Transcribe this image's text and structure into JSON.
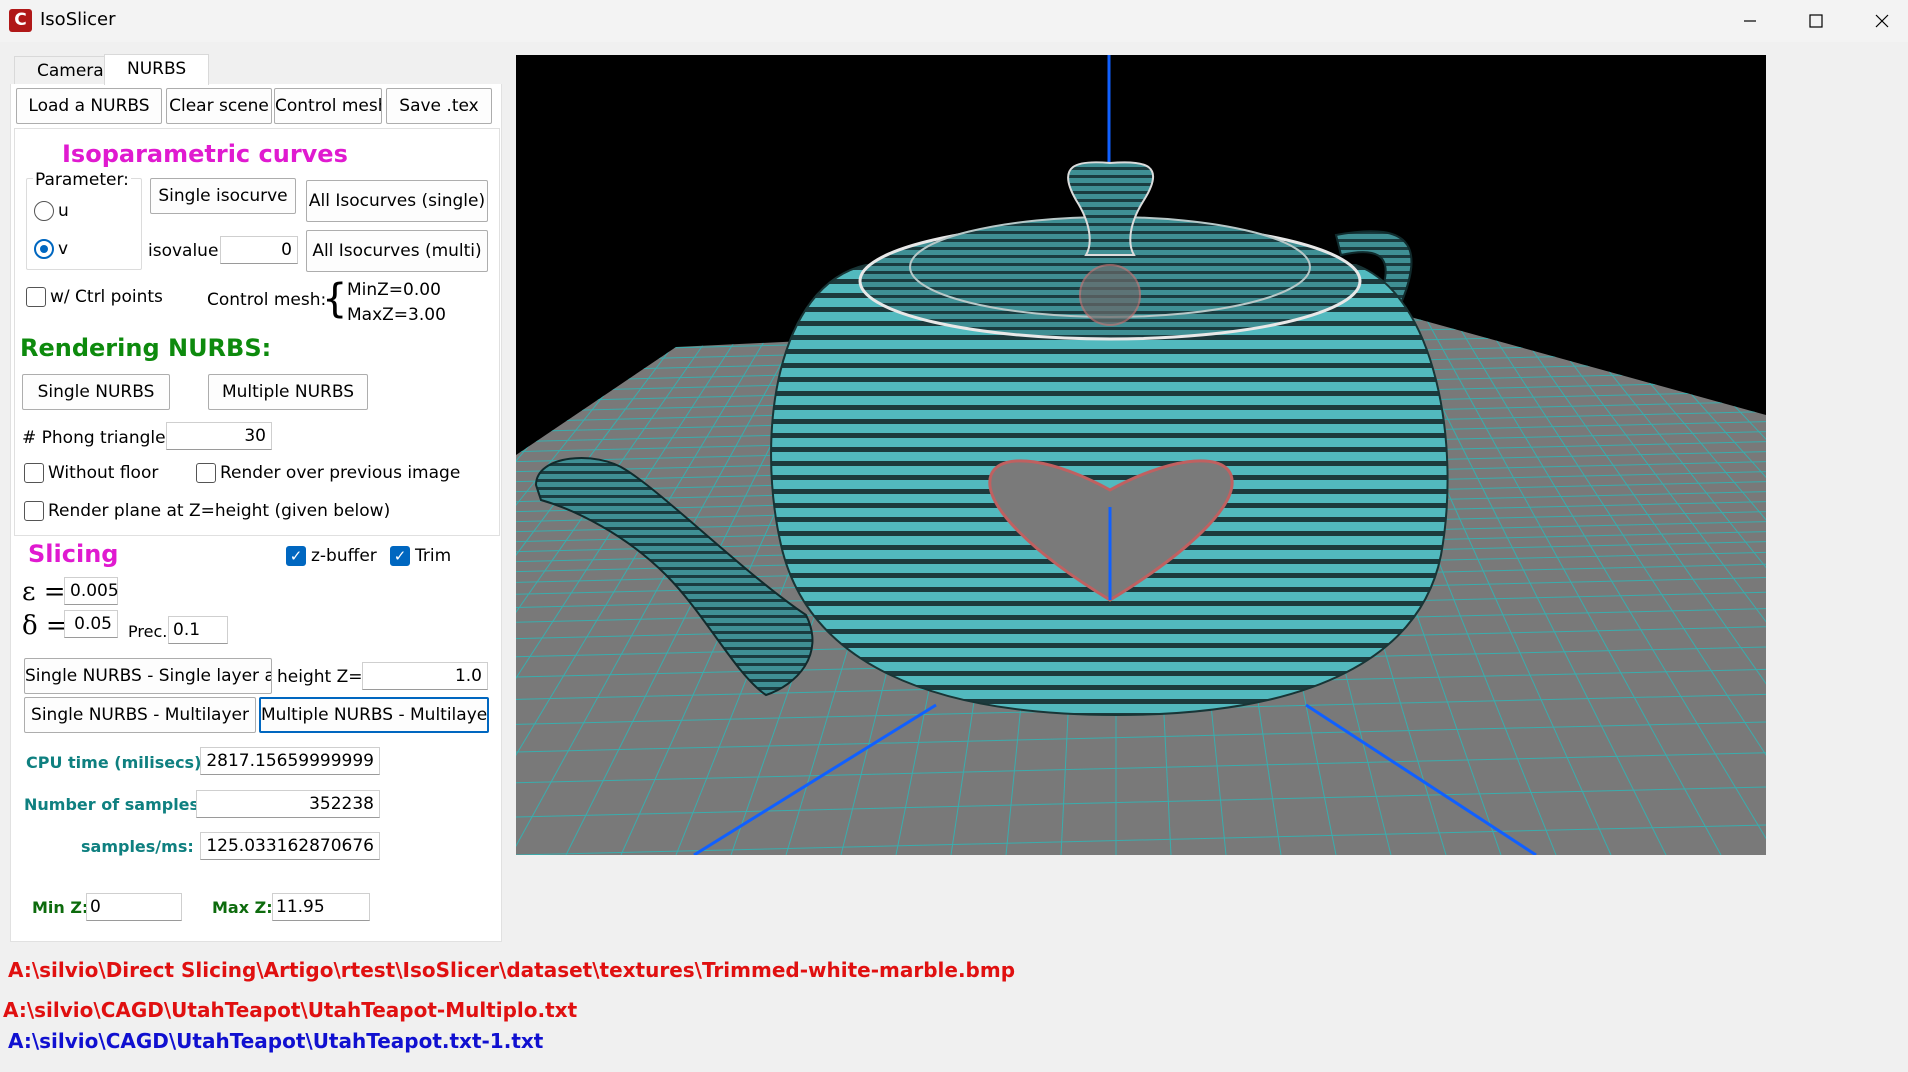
{
  "window": {
    "title": "IsoSlicer",
    "icon_letter": "C"
  },
  "tabs": [
    {
      "label": "Camera"
    },
    {
      "label": "NURBS"
    }
  ],
  "toolbar": {
    "load": "Load a NURBS",
    "clear": "Clear scene",
    "control_mesh": "Control mesh",
    "save": "Save .tex"
  },
  "iso": {
    "heading": "Isoparametric curves",
    "parameter_label": "Parameter:",
    "param_u": "u",
    "param_v": "v",
    "selected_param": "v",
    "single_btn": "Single isocurve",
    "all_single_btn": "All Isocurves (single)",
    "isovalue_label": "isovalue=",
    "isovalue": "0",
    "all_multi_btn": "All Isocurves (multi)",
    "ctrl_points_label": "w/ Ctrl points",
    "control_mesh_label": "Control mesh:",
    "minz": "MinZ=0.00",
    "maxz": "MaxZ=3.00"
  },
  "rendering": {
    "heading": "Rendering NURBS:",
    "single_btn": "Single NURBS",
    "multiple_btn": "Multiple NURBS",
    "phong_label": "# Phong triangles",
    "phong_value": "30",
    "without_floor": "Without floor",
    "render_over": "Render over previous image",
    "render_plane": "Render plane at Z=height (given below)"
  },
  "slicing": {
    "heading": "Slicing",
    "zbuffer": "z-buffer",
    "trim": "Trim",
    "epsilon_symbol": "ε =",
    "epsilon": "0.005",
    "delta_symbol": "δ =",
    "delta": "0.05",
    "prec_label": "Prec.:",
    "prec": "0.1",
    "single_layer_btn": "Single NURBS - Single layer at",
    "height_label": "height Z=",
    "height": "1.0",
    "single_multi_btn": "Single NURBS - Multilayer",
    "multi_multi_btn": "Multiple NURBS - Multilayer",
    "cpu_label": "CPU time (milisecs):",
    "cpu_value": "2817.15659999999",
    "samples_label": "Number of samples:",
    "samples_value": "352238",
    "rate_label": "samples/ms:",
    "rate_value": "125.033162870676",
    "minz_label": "Min Z:",
    "minz_value": "0",
    "maxz_label": "Max Z:",
    "maxz_value": "11.95"
  },
  "paths": [
    {
      "text": "A:\\silvio\\Direct Slicing\\Artigo\\rtest\\IsoSlicer\\dataset\\textures\\Trimmed-white-marble.bmp",
      "color": "#e01010"
    },
    {
      "text": "A:\\silvio\\CAGD\\UtahTeapot\\UtahTeapot-Multiplo.txt",
      "color": "#e01010"
    },
    {
      "text": "A:\\silvio\\CAGD\\UtahTeapot\\UtahTeapot.txt-1.txt",
      "color": "#1010d0"
    }
  ],
  "colors": {
    "accent": "#0067c0",
    "floor": "#7a7a7a",
    "grid": "#2fb3b3",
    "teapot": "#4fb8bd",
    "axis": "#1060ff"
  }
}
